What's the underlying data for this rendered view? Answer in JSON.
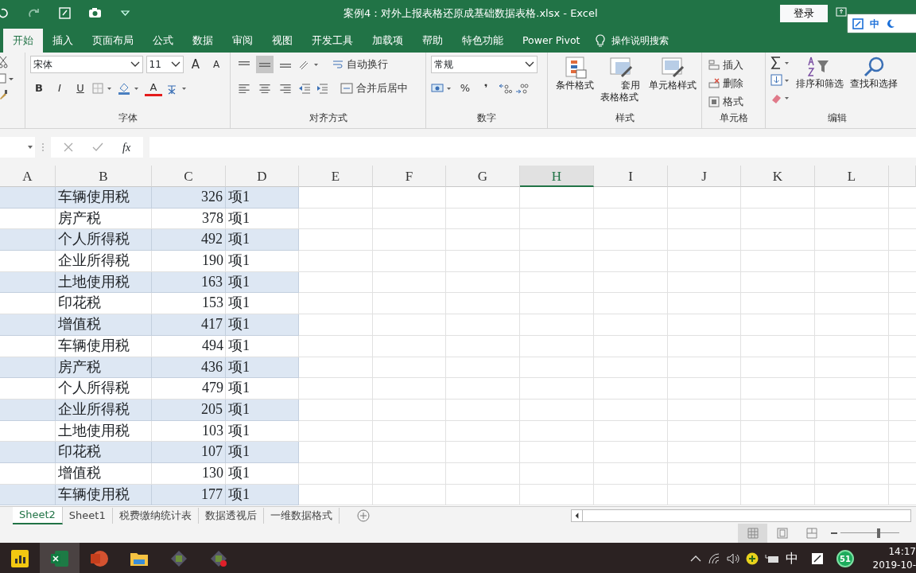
{
  "title_bar": {
    "quick_access": [
      {
        "kind": "undo"
      },
      {
        "kind": "redo"
      },
      {
        "kind": "touch"
      },
      {
        "kind": "camera"
      },
      {
        "kind": "customize"
      }
    ],
    "title": "案例4：对外上报表格还原成基础数据表格.xlsx - Excel",
    "login_button": "登录",
    "ime_toolbar": {
      "mode": "中"
    }
  },
  "ribbon_tabs": [
    {
      "label": "开始",
      "selected": true
    },
    {
      "label": "插入",
      "selected": false
    },
    {
      "label": "页面布局",
      "selected": false
    },
    {
      "label": "公式",
      "selected": false
    },
    {
      "label": "数据",
      "selected": false
    },
    {
      "label": "审阅",
      "selected": false
    },
    {
      "label": "视图",
      "selected": false
    },
    {
      "label": "开发工具",
      "selected": false
    },
    {
      "label": "加载项",
      "selected": false
    },
    {
      "label": "帮助",
      "selected": false
    },
    {
      "label": "特色功能",
      "selected": false
    },
    {
      "label": "Power Pivot",
      "selected": false
    }
  ],
  "tell_me": "操作说明搜索",
  "font_group": {
    "label": "字体",
    "font_name": "宋体",
    "font_size": "11",
    "grow": "A",
    "shrink": "A",
    "bold": "B",
    "italic": "I",
    "underline": "U",
    "font_color": "A"
  },
  "alignment_group": {
    "label": "对齐方式",
    "align_buttons": [
      {
        "kind": "top",
        "selected": false
      },
      {
        "kind": "middle",
        "selected": true
      },
      {
        "kind": "bottom",
        "selected": false
      },
      {
        "kind": "left",
        "selected": false
      },
      {
        "kind": "center",
        "selected": false
      },
      {
        "kind": "right",
        "selected": false
      }
    ],
    "wrap_text": "自动换行",
    "merge_center": "合并后居中"
  },
  "number_group": {
    "label": "数字",
    "format": "常规",
    "percent": "%",
    "comma": "❜"
  },
  "styles_group": {
    "label": "样式",
    "buttons": [
      {
        "kind": "conditional",
        "label": "条件格式"
      },
      {
        "kind": "table",
        "label": "套用表格格式"
      },
      {
        "kind": "cell",
        "label": "单元格样式"
      }
    ]
  },
  "cells_group": {
    "label": "单元格",
    "buttons": [
      {
        "kind": "insert",
        "label": "插入"
      },
      {
        "kind": "delete",
        "label": "删除"
      },
      {
        "kind": "format",
        "label": "格式"
      }
    ]
  },
  "editing_group": {
    "label": "编辑",
    "buttons": [
      {
        "kind": "sort",
        "label": "排序和筛选"
      },
      {
        "kind": "find",
        "label": "查找和选择"
      }
    ]
  },
  "formula_bar": {
    "fx": "fx"
  },
  "columns": [
    {
      "label": "A",
      "selected": false
    },
    {
      "label": "B",
      "selected": false
    },
    {
      "label": "C",
      "selected": false
    },
    {
      "label": "D",
      "selected": false
    },
    {
      "label": "E",
      "selected": false
    },
    {
      "label": "F",
      "selected": false
    },
    {
      "label": "G",
      "selected": false
    },
    {
      "label": "H",
      "selected": true
    },
    {
      "label": "I",
      "selected": false
    },
    {
      "label": "J",
      "selected": false
    },
    {
      "label": "K",
      "selected": false
    },
    {
      "label": "L",
      "selected": false
    }
  ],
  "rows": [
    {
      "tax": "车辆使用税",
      "amount": "326",
      "item": "项1"
    },
    {
      "tax": "房产税",
      "amount": "378",
      "item": "项1"
    },
    {
      "tax": "个人所得税",
      "amount": "492",
      "item": "项1"
    },
    {
      "tax": "企业所得税",
      "amount": "190",
      "item": "项1"
    },
    {
      "tax": "土地使用税",
      "amount": "163",
      "item": "项1"
    },
    {
      "tax": "印花税",
      "amount": "153",
      "item": "项1"
    },
    {
      "tax": "增值税",
      "amount": "417",
      "item": "项1"
    },
    {
      "tax": "车辆使用税",
      "amount": "494",
      "item": "项1"
    },
    {
      "tax": "房产税",
      "amount": "436",
      "item": "项1"
    },
    {
      "tax": "个人所得税",
      "amount": "479",
      "item": "项1"
    },
    {
      "tax": "企业所得税",
      "amount": "205",
      "item": "项1"
    },
    {
      "tax": "土地使用税",
      "amount": "103",
      "item": "项1"
    },
    {
      "tax": "印花税",
      "amount": "107",
      "item": "项1"
    },
    {
      "tax": "增值税",
      "amount": "130",
      "item": "项1"
    },
    {
      "tax": "车辆使用税",
      "amount": "177",
      "item": "项1"
    }
  ],
  "sheet_tabs": [
    {
      "label": "Sheet2",
      "selected": true
    },
    {
      "label": "Sheet1",
      "selected": false
    },
    {
      "label": "税费缴纳统计表",
      "selected": false
    },
    {
      "label": "数据透视后",
      "selected": false
    },
    {
      "label": "一维数据格式",
      "selected": false
    }
  ],
  "status_bar": {
    "views": [
      {
        "kind": "normal",
        "selected": true
      },
      {
        "kind": "page-layout",
        "selected": false
      },
      {
        "kind": "page-break",
        "selected": false
      }
    ],
    "zoom": {
      "level": 0.62
    }
  },
  "taskbar": {
    "apps": [
      {
        "kind": "chart-app",
        "active": false
      },
      {
        "kind": "excel",
        "active": true
      },
      {
        "kind": "powerpoint",
        "active": false
      },
      {
        "kind": "folder",
        "active": false
      },
      {
        "kind": "green-app",
        "active": false
      },
      {
        "kind": "record-app",
        "active": false
      }
    ],
    "ime": "中",
    "badge": "51",
    "time": "14:17",
    "date": "2019-10-"
  }
}
